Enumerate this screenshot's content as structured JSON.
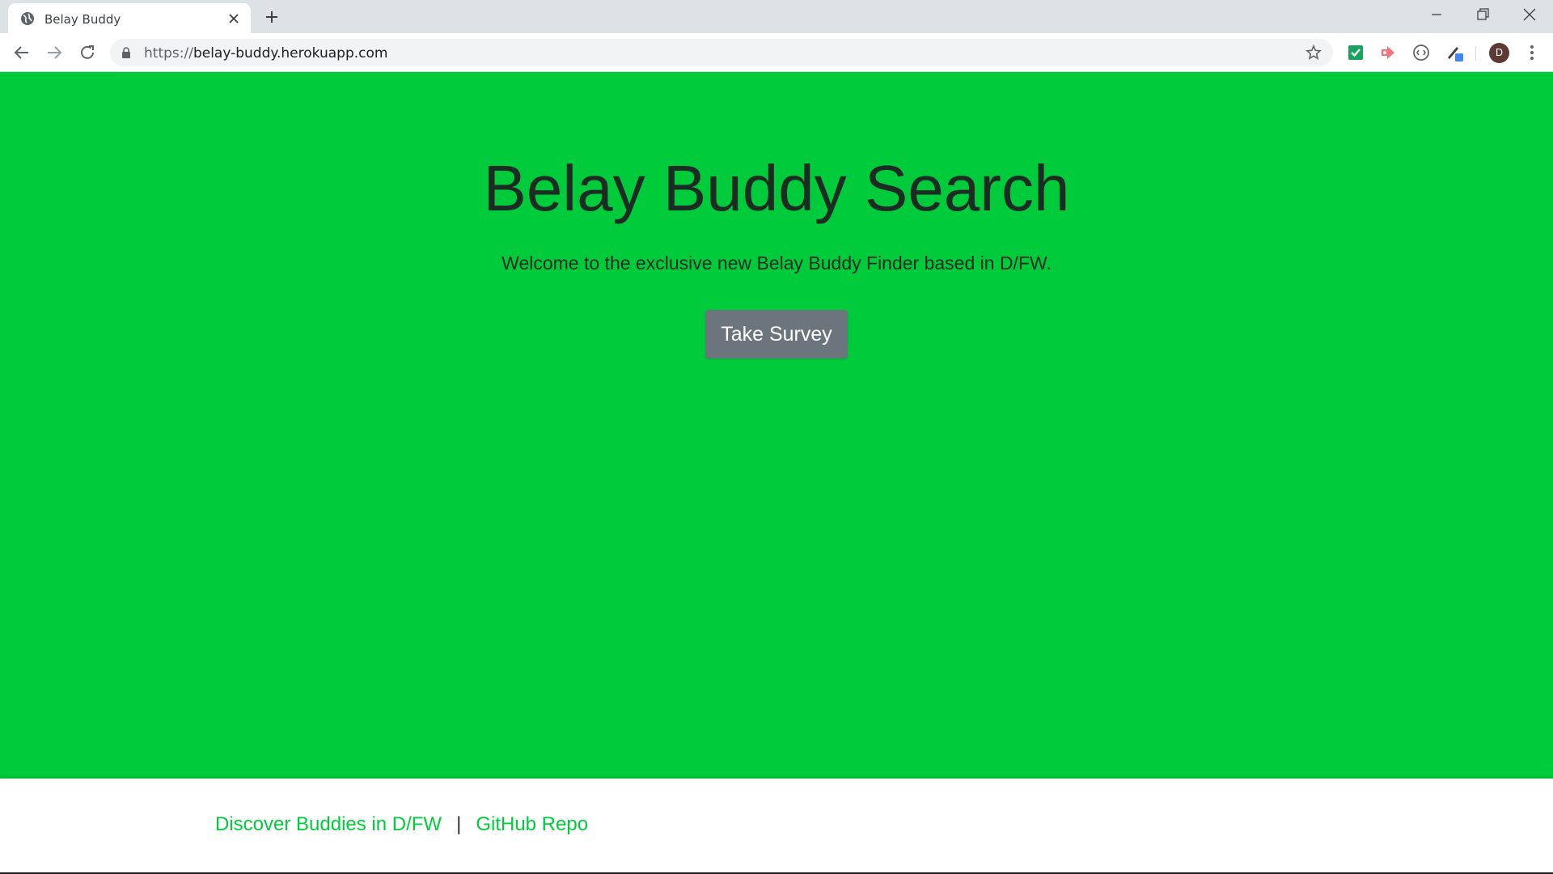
{
  "browser": {
    "tab_title": "Belay Buddy",
    "url_scheme": "https://",
    "url_host": "belay-buddy.herokuapp.com",
    "profile_initial": "D"
  },
  "hero": {
    "background": "#00cc3b",
    "title": "Belay Buddy Search",
    "lead": "Welcome to the exclusive new Belay Buddy Finder based in D/FW.",
    "button_label": "Take Survey"
  },
  "footer": {
    "link_discover": "Discover Buddies in D/FW",
    "divider": "|",
    "link_github": "GitHub Repo",
    "link_color": "#00cc3b"
  },
  "icons": {
    "tab_favicon": "globe-icon",
    "tab_close": "close-icon",
    "new_tab": "plus-icon",
    "back": "arrow-left-icon",
    "forward": "arrow-right-icon",
    "reload": "reload-icon",
    "lock": "lock-icon",
    "bookmark": "star-icon",
    "extensions": [
      "checkmark-extension-icon",
      "arrow-extension-icon",
      "circle-extension-icon",
      "pen-extension-icon"
    ],
    "menu": "kebab-menu-icon"
  }
}
